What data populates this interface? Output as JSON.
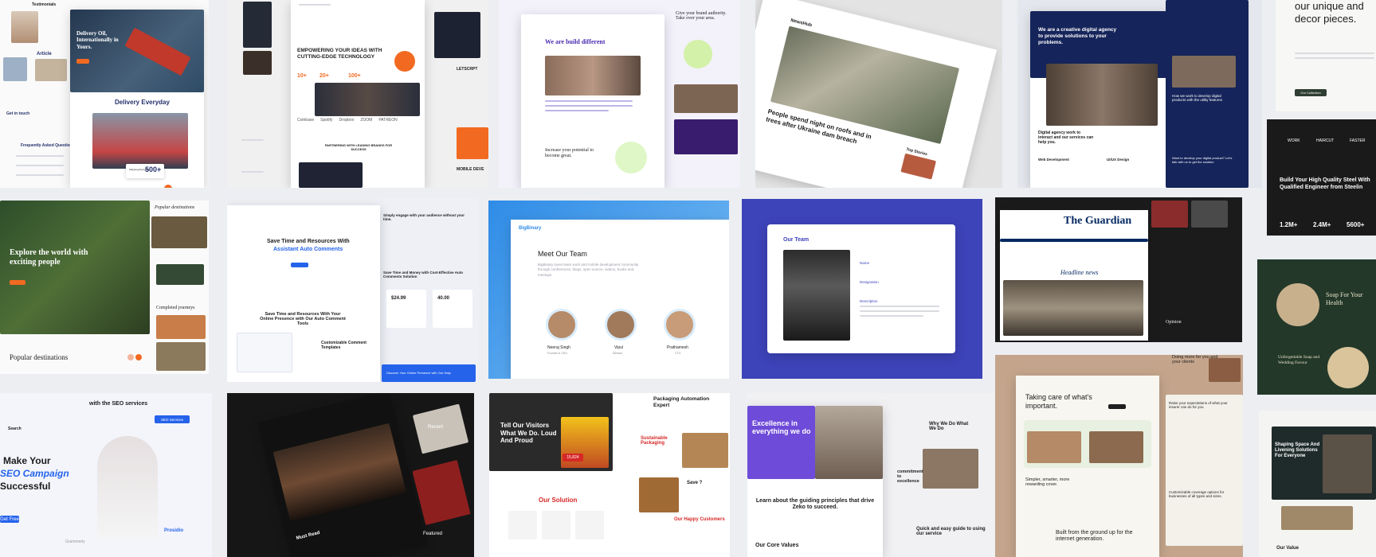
{
  "t1": {
    "testimonial": "Testimonials",
    "article": "Article",
    "get_in_touch": "Get in touch",
    "hero_title": "Delivery Oil, Internationally in Yours.",
    "delivery": "Delivery Everyday",
    "faq": "Frequently Asked Question",
    "stat_label": "Shipping Everyday",
    "stat_value": "500+"
  },
  "t2": {
    "hero_title": "EMPOWERING YOUR IDEAS WITH CUTTING-EDGE TECHNOLOGY",
    "stats": [
      "10+",
      "20+",
      "100+"
    ],
    "partner_brands": [
      "Coinbase",
      "Spotify",
      "Dropbox",
      "ZOOM",
      "PATREON"
    ],
    "partnering": "PARTNERING WITH LEADING BRANDS FOR SUCCESS",
    "side_label_1": "LETSCRPT",
    "side_label_2": "MOBILE DEVE"
  },
  "t3": {
    "hero_title": "We are build different",
    "section_title": "Increase your potential to become great.",
    "side_title": "Give your brand authority. Take over your area."
  },
  "t4": {
    "tag": "NewsHub",
    "headline": "People spend night on roofs and in trees after Ukraine dam breach",
    "top_stories": "Top Stories"
  },
  "t5": {
    "hero_title": "We are a creative digital agency to provide solutions to your problems.",
    "section_title": "Digital agency work to interact and our services can help you.",
    "service_1": "Web Development",
    "service_2": "UI/UX Design",
    "side_title": "How we work to develop digital products with the utility features",
    "cta": "Want to develop your digital product? Let's talk with us to get the solution"
  },
  "t6": {
    "title": "our unique and decor pieces.",
    "button": "Our Collection"
  },
  "t7": {
    "hero_title": "Explore the world with exciting people",
    "popular": "Popular destinations",
    "side_title": "Popular destinations",
    "completed": "Completed journeys"
  },
  "t8": {
    "hero_title": "Save Time and Resources With",
    "hero_accent": "Assistant Auto Comments",
    "section_title": "Save Time and Resources With Your Online Presence with Our Auto Comment Tools",
    "customizable": "Customizable Comment Templates",
    "side_title": "Save Time and Money with Cost-Effective Auto Comments Solution",
    "price_1": "$24.99",
    "price_2": "40.00",
    "side_top": "Simply engage with your audience without your time.",
    "footer_text": "Discover Your Online Presence with Our Help"
  },
  "t9": {
    "brand": "BigBinary",
    "title": "Meet Our Team",
    "desc": "BigBinary loves team work and mobile development community through conferences, blogs, open source, videos, books and meetups.",
    "members": [
      {
        "name": "Neeraj Singh",
        "role": "Founder & CEO"
      },
      {
        "name": "Vipul",
        "role": "Director"
      },
      {
        "name": "Prathamesh",
        "role": "CTO"
      }
    ]
  },
  "t10": {
    "title": "Our Team",
    "field_1": "Name",
    "field_2": "Designation",
    "field_3": "Description"
  },
  "t11": {
    "logo": "The Guardian",
    "headline": "Headline news",
    "quote": "Opinion"
  },
  "t12": {
    "brand_1": "WORK",
    "brand_2": "HAIRCUT",
    "brand_3": "FASTER",
    "hero_title": "Build Your High Quality Steel With Qualified Engineer from Steelin",
    "stats": [
      "1.2M+",
      "2.4M+",
      "5600+"
    ]
  },
  "t13": {
    "title": "Soap For Your Health",
    "subtitle": "Unforgettable Soap and Wedding Favour"
  },
  "t14": {
    "services": "with the SEO services",
    "hero_title_1": "Make Your",
    "hero_title_2": "SEO Campaign",
    "hero_title_3": "Successful",
    "nav_brand": "Search",
    "badge": "SEO Services",
    "button": "Get Free",
    "side_logos": [
      "Grammarly",
      "Prosidio"
    ]
  },
  "t15": {
    "caption": "Must Read",
    "side_text": "Featured",
    "bottom_text": "Recent"
  },
  "t16": {
    "hero_title": "Tell Our Visitors What We Do. Loud And Proud",
    "badge": "15,824",
    "solution": "Our Solution",
    "right_title": "Packaging Automation Expert",
    "sustainable": "Sustainable Packaging",
    "happy": "Our Happy Customers",
    "box_label": "Save ?"
  },
  "t17": {
    "hero_title": "Excellence in everything we do",
    "section_title": "Learn about the guiding principles that drive Zeko to succeed.",
    "values": "Our Core Values",
    "right_title": "Why We Do What We Do",
    "commitment": "commitment to excellence",
    "bottom_right": "Quick and easy guide to using our service"
  },
  "t18": {
    "hero_title": "Taking care of what's important.",
    "built": "Built from the ground up for the internet generation.",
    "simpler": "Simpler, smarter, more rewarding cover.",
    "side_1": "Doing more for you and your clients",
    "side_2": "Raise your expectations of what your insurer can do for you",
    "side_3": "Customizable coverage options for businesses of all types and sizes."
  },
  "t19": {
    "hero_title": "Shaping Space And Livening Solutions For Everyone",
    "value": "Our Value"
  },
  "colors": {
    "orange": "#f26a21",
    "purple": "#6e4bd8",
    "navy": "#15245a",
    "blue": "#2563eb",
    "guardian": "#052962",
    "green": "#1f4a3a"
  }
}
